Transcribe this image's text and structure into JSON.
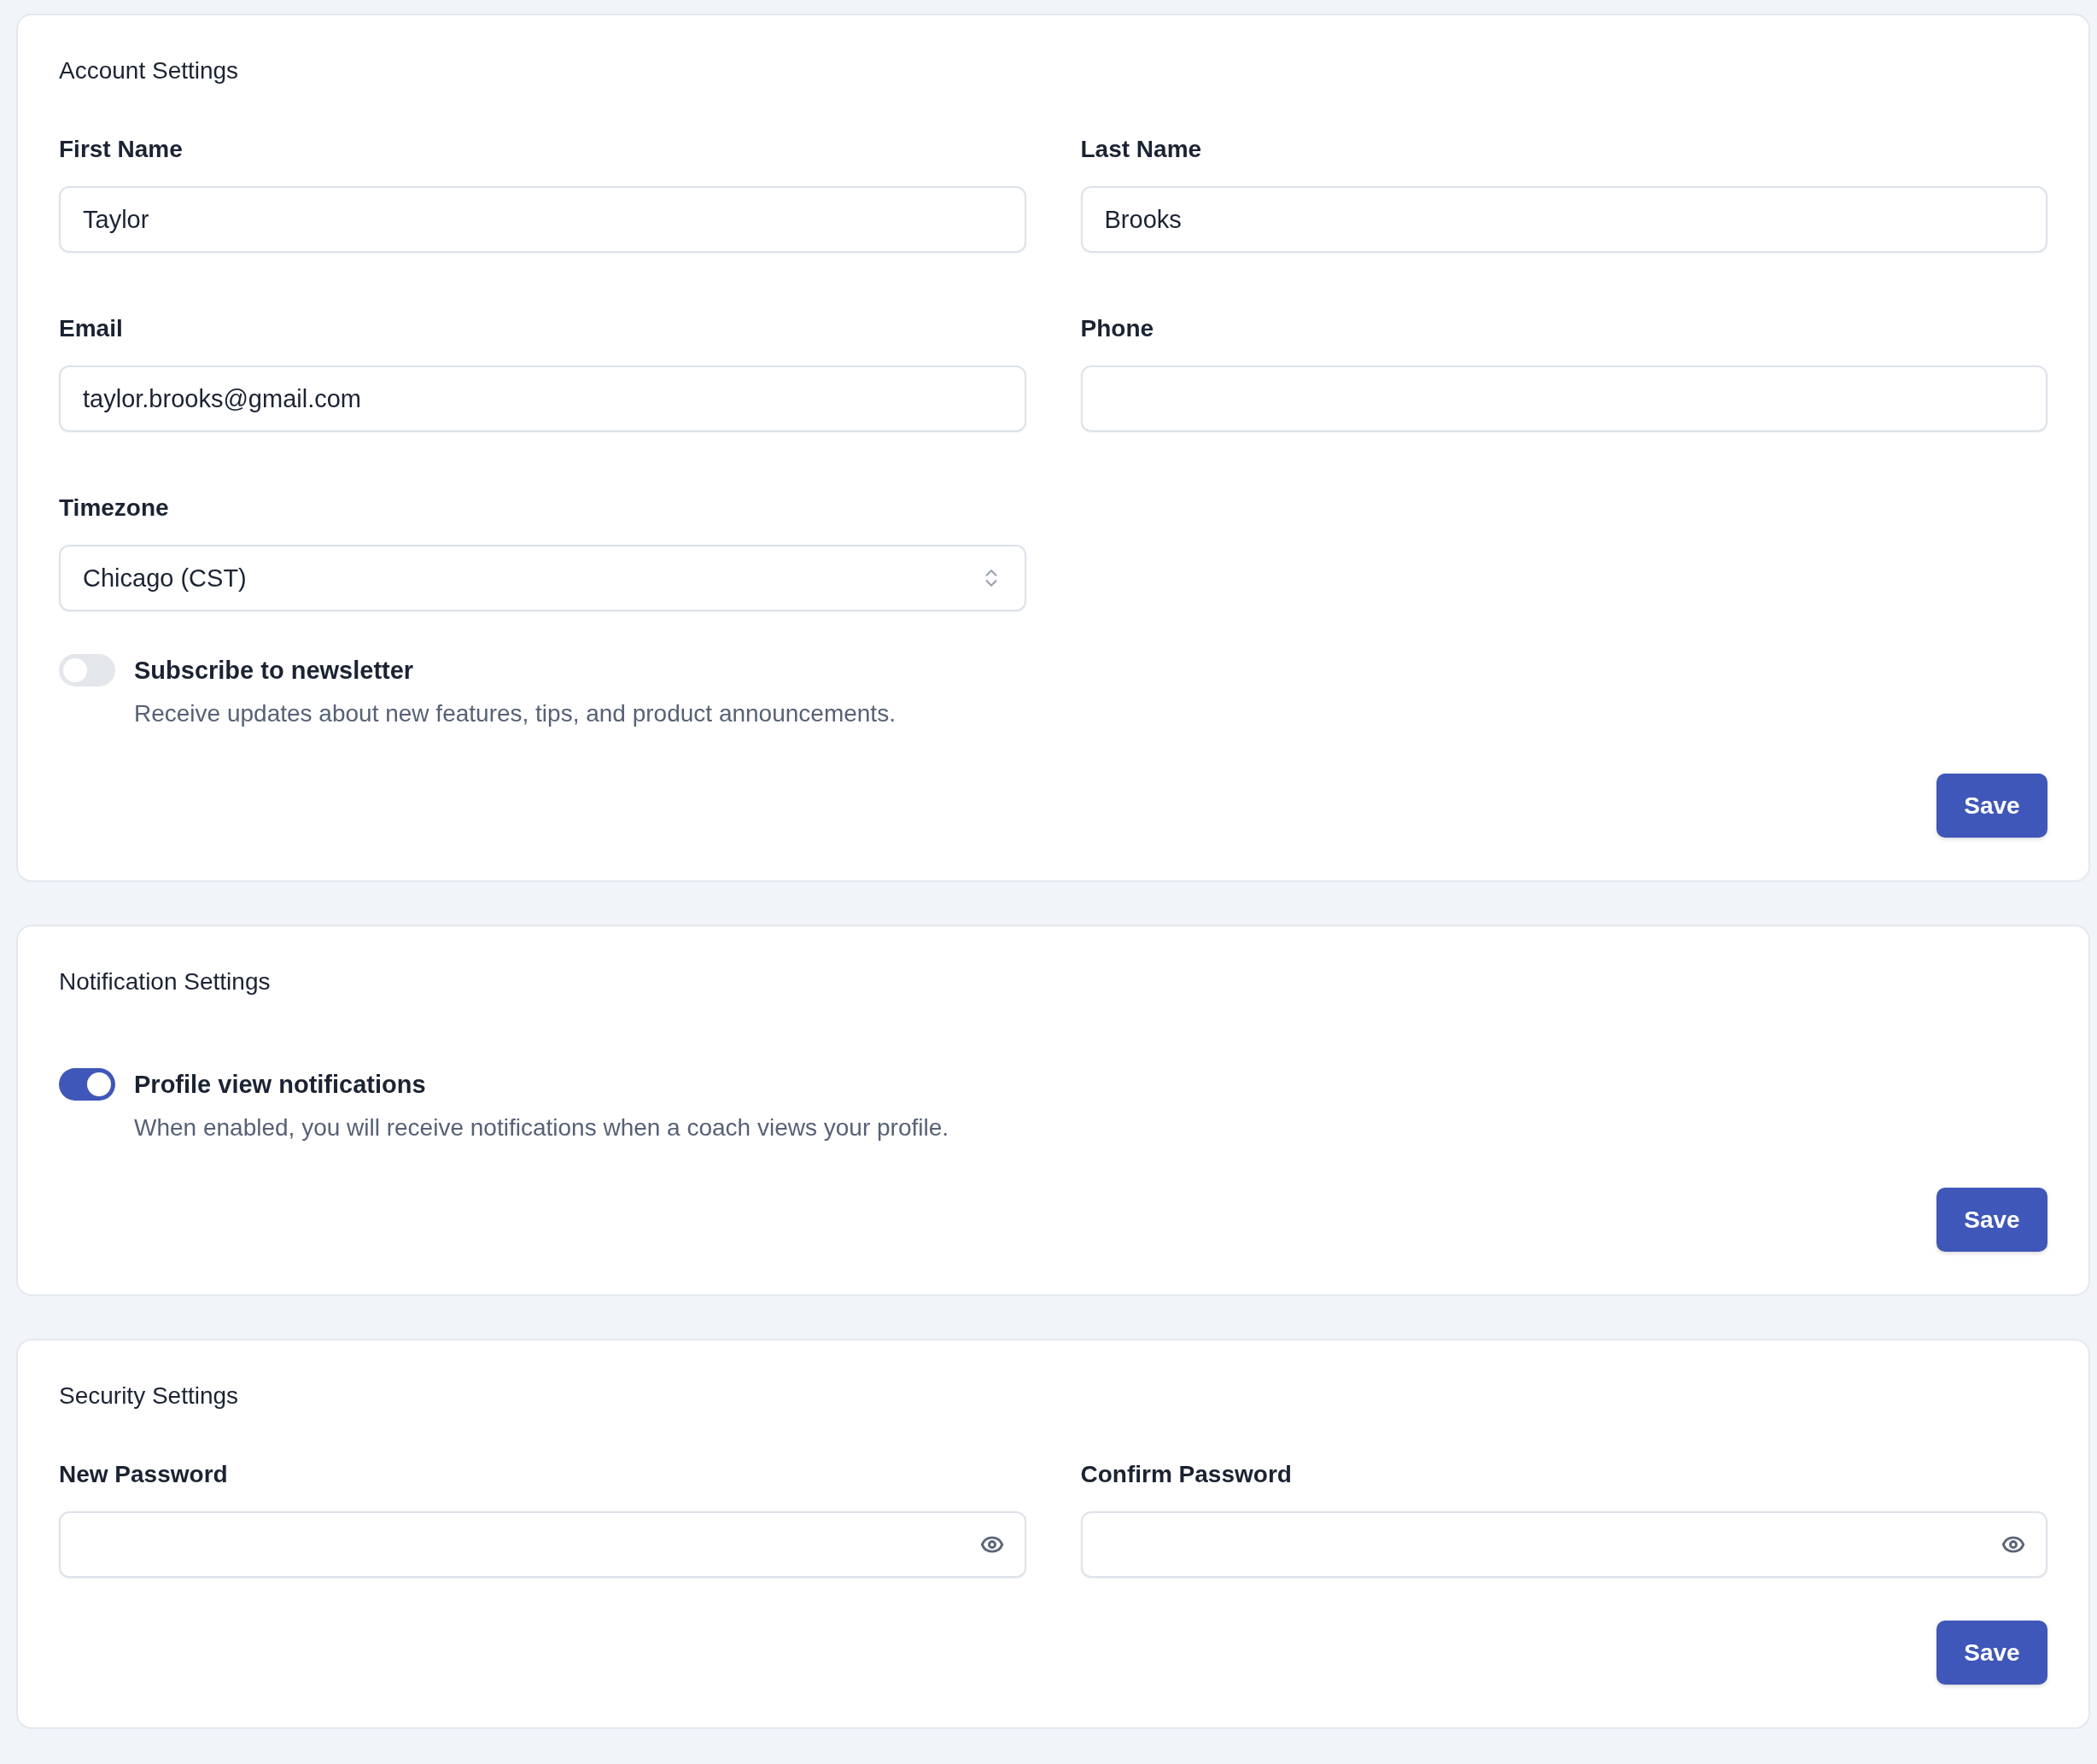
{
  "sections": [
    {
      "title": "Account Settings",
      "fields": [
        {
          "kind": "text",
          "label": "First Name",
          "value": "Taylor"
        },
        {
          "kind": "text",
          "label": "Last Name",
          "value": "Brooks"
        },
        {
          "kind": "text",
          "label": "Email",
          "value": "taylor.brooks@gmail.com"
        },
        {
          "kind": "text",
          "label": "Phone"
        },
        {
          "kind": "select",
          "label": "Timezone",
          "value": "Chicago (CST)"
        }
      ],
      "toggles": [
        {
          "label": "Subscribe to newsletter",
          "description": "Receive updates about new features, tips, and product announcements.",
          "on": false
        }
      ],
      "button": "Save"
    },
    {
      "title": "Notification Settings",
      "toggles": [
        {
          "label": "Profile view notifications",
          "description": "When enabled, you will receive notifications when a coach views your profile.",
          "on": true
        }
      ],
      "button": "Save"
    },
    {
      "title": "Security Settings",
      "fields": [
        {
          "kind": "password",
          "label": "New Password"
        },
        {
          "kind": "password",
          "label": "Confirm Password"
        }
      ],
      "button": "Save"
    }
  ]
}
